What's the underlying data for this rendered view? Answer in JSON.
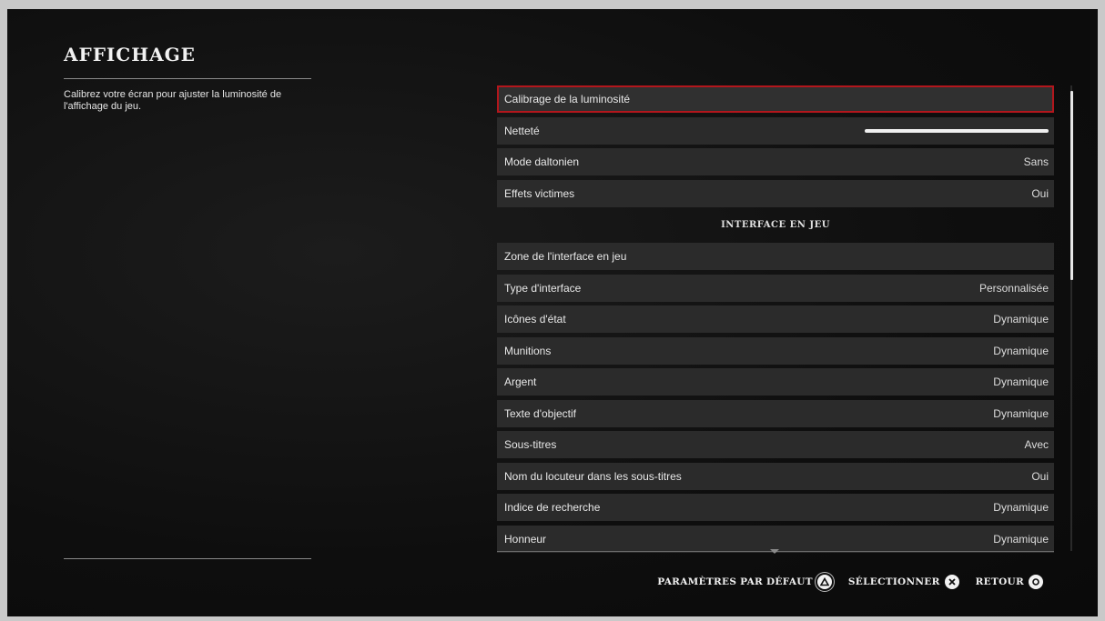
{
  "page": {
    "title": "AFFICHAGE",
    "description": "Calibrez votre écran pour ajuster la luminosité de l'affichage du jeu."
  },
  "rows": [
    {
      "label": "Calibrage de la luminosité",
      "value": ""
    },
    {
      "label": "Netteté",
      "value": "",
      "slider_level": 1.0
    },
    {
      "label": "Mode daltonien",
      "value": "Sans"
    },
    {
      "label": "Effets victimes",
      "value": "Oui"
    },
    {
      "label": "INTERFACE EN JEU",
      "value": ""
    },
    {
      "label": "Zone de l'interface en jeu",
      "value": ""
    },
    {
      "label": "Type d'interface",
      "value": "Personnalisée"
    },
    {
      "label": "Icônes d'état",
      "value": "Dynamique"
    },
    {
      "label": "Munitions",
      "value": "Dynamique"
    },
    {
      "label": "Argent",
      "value": "Dynamique"
    },
    {
      "label": "Texte d'objectif",
      "value": "Dynamique"
    },
    {
      "label": "Sous-titres",
      "value": "Avec"
    },
    {
      "label": "Nom du locuteur dans les sous-titres",
      "value": "Oui"
    },
    {
      "label": "Indice de recherche",
      "value": "Dynamique"
    },
    {
      "label": "Honneur",
      "value": "Dynamique"
    }
  ],
  "footer": {
    "defaults_label": "PARAMÈTRES PAR DÉFAUT",
    "select_label": "SÉLECTIONNER",
    "back_label": "RETOUR",
    "defaults_icon": "triangle-button-icon",
    "select_icon": "cross-button-icon",
    "back_icon": "circle-button-icon"
  },
  "colors": {
    "selection_border": "#b3161c",
    "row_background": "#2b2b2b"
  }
}
